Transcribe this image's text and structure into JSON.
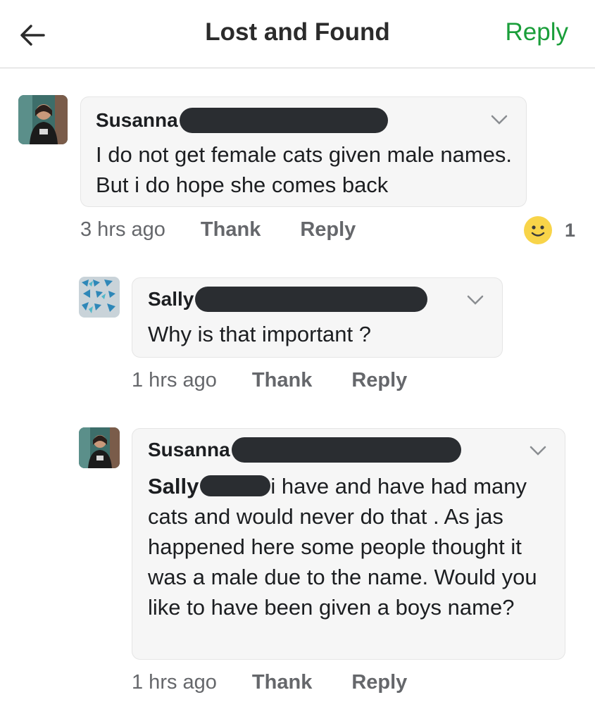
{
  "header": {
    "title": "Lost and Found",
    "reply_label": "Reply",
    "back_icon": "back-arrow-icon"
  },
  "comments": [
    {
      "author": "Susanna",
      "text": "I do not get female cats given male names. But i do hope she comes back",
      "time": "3 hrs ago",
      "thank_label": "Thank",
      "reply_label": "Reply",
      "reaction_count": "1"
    },
    {
      "author": "Sally",
      "text": "Why is that important ?",
      "time": "1 hrs ago",
      "thank_label": "Thank",
      "reply_label": "Reply"
    },
    {
      "author": "Susanna",
      "mention": "Sally",
      "text": "i have  and have had many cats and would never do that . As jas happened here some people thought it was a male due to the name. Would you like to have been given a boys name?",
      "time": "1 hrs ago",
      "thank_label": "Thank",
      "reply_label": "Reply"
    }
  ],
  "colors": {
    "accent": "#1a9e3a",
    "meta": "#65676b",
    "bubble": "#f6f6f6",
    "redaction": "#2a2d31",
    "reaction": "#f8d449"
  }
}
